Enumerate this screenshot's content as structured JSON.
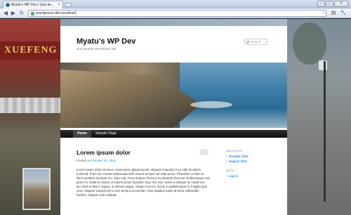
{
  "browser": {
    "tab_title": "Myatu's WP Dev | Just an...",
    "url": "wordpress-dev.localnet/",
    "win_min": "–",
    "win_max": "□",
    "win_close": "×"
  },
  "site": {
    "title": "Myatu's WP Dev",
    "description": "Just another WordPress site",
    "search_placeholder": "Search",
    "nav": [
      "Home",
      "Sample Page"
    ]
  },
  "post": {
    "title": "Lorem ipsum dolor",
    "posted_on_label": "Posted on",
    "date": "October 23, 2011",
    "body": "Lorem ipsum dolor sit amet, consectetur adipiscing elit. Aliquam imperdiet mi a nibh hendrerit euismod. Proin nec massa malesuada nibh viverra tempus vel vitae purus. Phasellus et diam et libero porttitor tincidunt nec vitae erat. Proin tempus rhoncus mi pharetra rhoncus. Pellentesque sed justo leo. Nulla eu metus ut mauris luctus faucibus. Duis nisi erat, varius a tristique id, mattis nec leo. Duis et libero magna, ut ultrices augue. Integer eros mi, luctus in pellentesque id, fringilla quis urna. Aliquam suscipit nisi a eros tempus accumsan. Duis dapibus turpis at tortor sollicitudin facilisis. Aliquam erat volutpat."
  },
  "sidebar": {
    "archives_heading": "ARCHIVES",
    "archives": [
      "October 2011",
      "August 2011"
    ],
    "meta_heading": "META",
    "meta": [
      "Log in"
    ]
  },
  "background": {
    "sign_text": "XUEFENG"
  }
}
